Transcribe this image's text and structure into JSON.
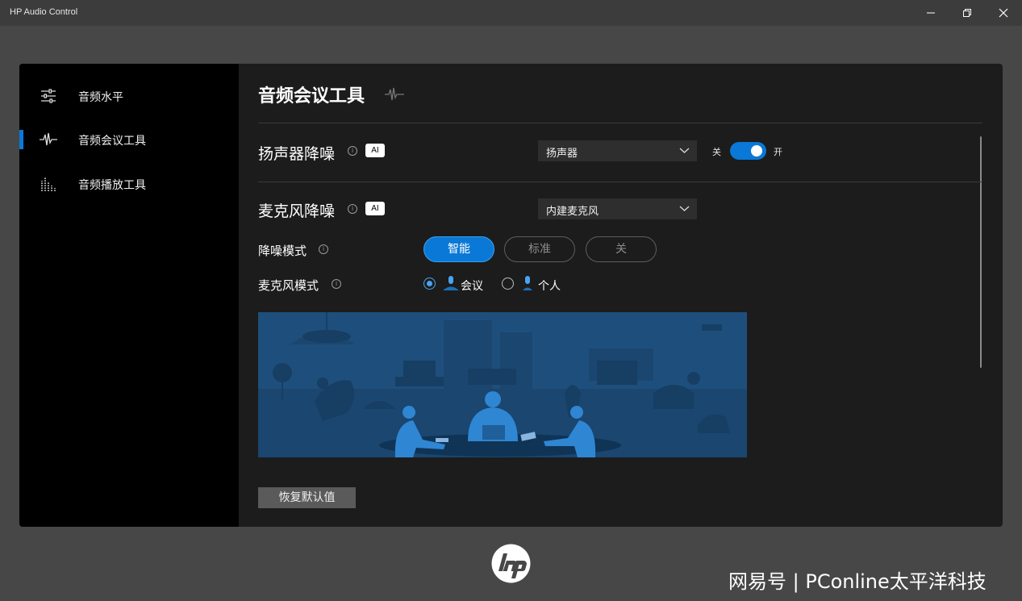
{
  "window": {
    "title": "HP Audio Control",
    "controls": [
      "minimize",
      "restore",
      "close"
    ]
  },
  "sidebar": {
    "items": [
      {
        "label": "音频水平",
        "icon": "sliders-icon",
        "selected": false
      },
      {
        "label": "音频会议工具",
        "icon": "waveform-icon",
        "selected": true
      },
      {
        "label": "音频播放工具",
        "icon": "equalizer-bars-icon",
        "selected": false
      }
    ]
  },
  "main": {
    "title": "音频会议工具",
    "speaker": {
      "title": "扬声器降噪",
      "badge": "AI",
      "device": "扬声器",
      "toggle_off_label": "关",
      "toggle_on_label": "开",
      "enabled": true
    },
    "mic": {
      "title": "麦克风降噪",
      "badge": "AI",
      "device": "内建麦克风",
      "noise_mode": {
        "label": "降噪模式",
        "options": [
          "智能",
          "标准",
          "关"
        ],
        "selected": "智能"
      },
      "mic_mode": {
        "label": "麦克风模式",
        "options": [
          "会议",
          "个人"
        ],
        "selected": "会议"
      }
    },
    "reset_label": "恢复默认值"
  },
  "footer": {
    "watermark": "网易号 | PConline太平洋科技"
  },
  "colors": {
    "accent": "#0a78d6",
    "background": "#474747",
    "panel": "#1c1c1c",
    "sidebar": "#000000"
  }
}
